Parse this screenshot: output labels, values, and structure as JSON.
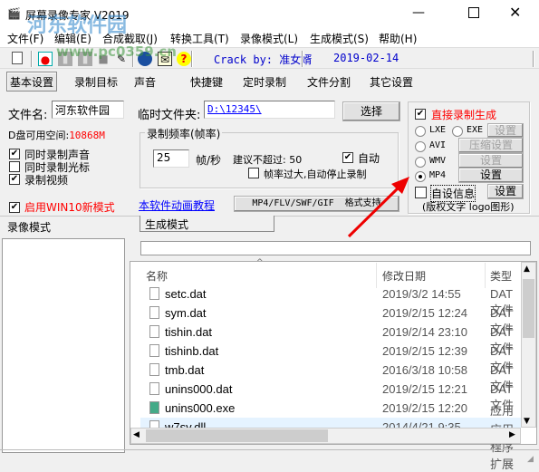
{
  "window": {
    "title": "屏幕录像专家 V2019",
    "controls": [
      "minimize",
      "maximize",
      "close"
    ]
  },
  "watermark": {
    "text": "河东软件园",
    "url": "www.pc0359.cn"
  },
  "menu": [
    "文件(F)",
    "编辑(E)",
    "合成截取(J)",
    "转换工具(T)",
    "录像模式(L)",
    "生成模式(S)",
    "帮助(H)"
  ],
  "toolbar": {
    "icons": [
      "new-icon",
      "record-icon",
      "pause-icon",
      "stop-icon",
      "camera-icon",
      "pen-icon",
      "globe-icon",
      "register-icon",
      "help-icon"
    ],
    "help_glyph": "?",
    "crack": "Crack by: 准女婿",
    "date": "2019-02-14"
  },
  "tabs": [
    "基本设置",
    "录制目标",
    "声音",
    "快捷键",
    "定时录制",
    "文件分割",
    "其它设置"
  ],
  "basic": {
    "filename_label": "文件名:",
    "filename_value": "河东软件园",
    "temp_label": "临时文件夹:",
    "temp_value": "D:\\12345\\",
    "choose_btn": "选择",
    "disk_label": "D盘可用空间:",
    "disk_value": "10868M",
    "checks": [
      {
        "label": "同时录制声音",
        "checked": true
      },
      {
        "label": "同时录制光标",
        "checked": false
      },
      {
        "label": "录制视频",
        "checked": true
      }
    ],
    "win10": {
      "label": "启用WIN10新模式",
      "checked": true
    },
    "fps_group": "录制频率(帧率)",
    "fps_value": "25",
    "fps_unit": "帧/秒",
    "fps_hint": "建议不超过: 50",
    "auto": {
      "label": "自动",
      "checked": true
    },
    "auto_stop": {
      "label": "帧率过大,自动停止录制",
      "checked": false
    },
    "tutorial_link": "本软件动画教程",
    "format_btn": "MP4/FLV/SWF/GIF  格式支持",
    "direct": {
      "label": "直接录制生成",
      "checked": true
    },
    "formats": [
      {
        "label": "LXE",
        "selected": false
      },
      {
        "label": "EXE",
        "selected": false
      },
      {
        "label": "AVI",
        "selected": false
      },
      {
        "label": "WMV",
        "selected": false
      },
      {
        "label": "MP4",
        "selected": true
      }
    ],
    "set_btn": "设置",
    "compress_btn": "压缩设置",
    "custom_info": {
      "label": "自设信息",
      "checked": false
    },
    "custom_hint": "(版权文字 logo图形)"
  },
  "panels": {
    "left_title": "录像模式",
    "right_tab": "生成模式"
  },
  "files": {
    "headers": [
      "名称",
      "修改日期",
      "类型"
    ],
    "rows": [
      {
        "name": "setc.dat",
        "date": "2019/3/2 14:55",
        "type": "DAT 文件",
        "icon": "file-icon"
      },
      {
        "name": "sym.dat",
        "date": "2019/2/15 12:24",
        "type": "DAT 文件",
        "icon": "file-icon"
      },
      {
        "name": "tishin.dat",
        "date": "2019/2/14 23:10",
        "type": "DAT 文件",
        "icon": "file-icon"
      },
      {
        "name": "tishinb.dat",
        "date": "2019/2/15 12:39",
        "type": "DAT 文件",
        "icon": "file-icon"
      },
      {
        "name": "tmb.dat",
        "date": "2016/3/18 10:58",
        "type": "DAT 文件",
        "icon": "file-icon"
      },
      {
        "name": "unins000.dat",
        "date": "2019/2/15 12:21",
        "type": "DAT 文件",
        "icon": "file-icon"
      },
      {
        "name": "unins000.exe",
        "date": "2019/2/15 12:20",
        "type": "应用程序",
        "icon": "installer-icon"
      },
      {
        "name": "w7sy.dll",
        "date": "2014/4/21 9:35",
        "type": "应用程序扩展",
        "icon": "dll-icon",
        "selected": true
      }
    ]
  },
  "colors": {
    "red": "#ff0000",
    "link": "#0000ff",
    "crack": "#0000cc",
    "selected_row": "#e5f3ff"
  }
}
